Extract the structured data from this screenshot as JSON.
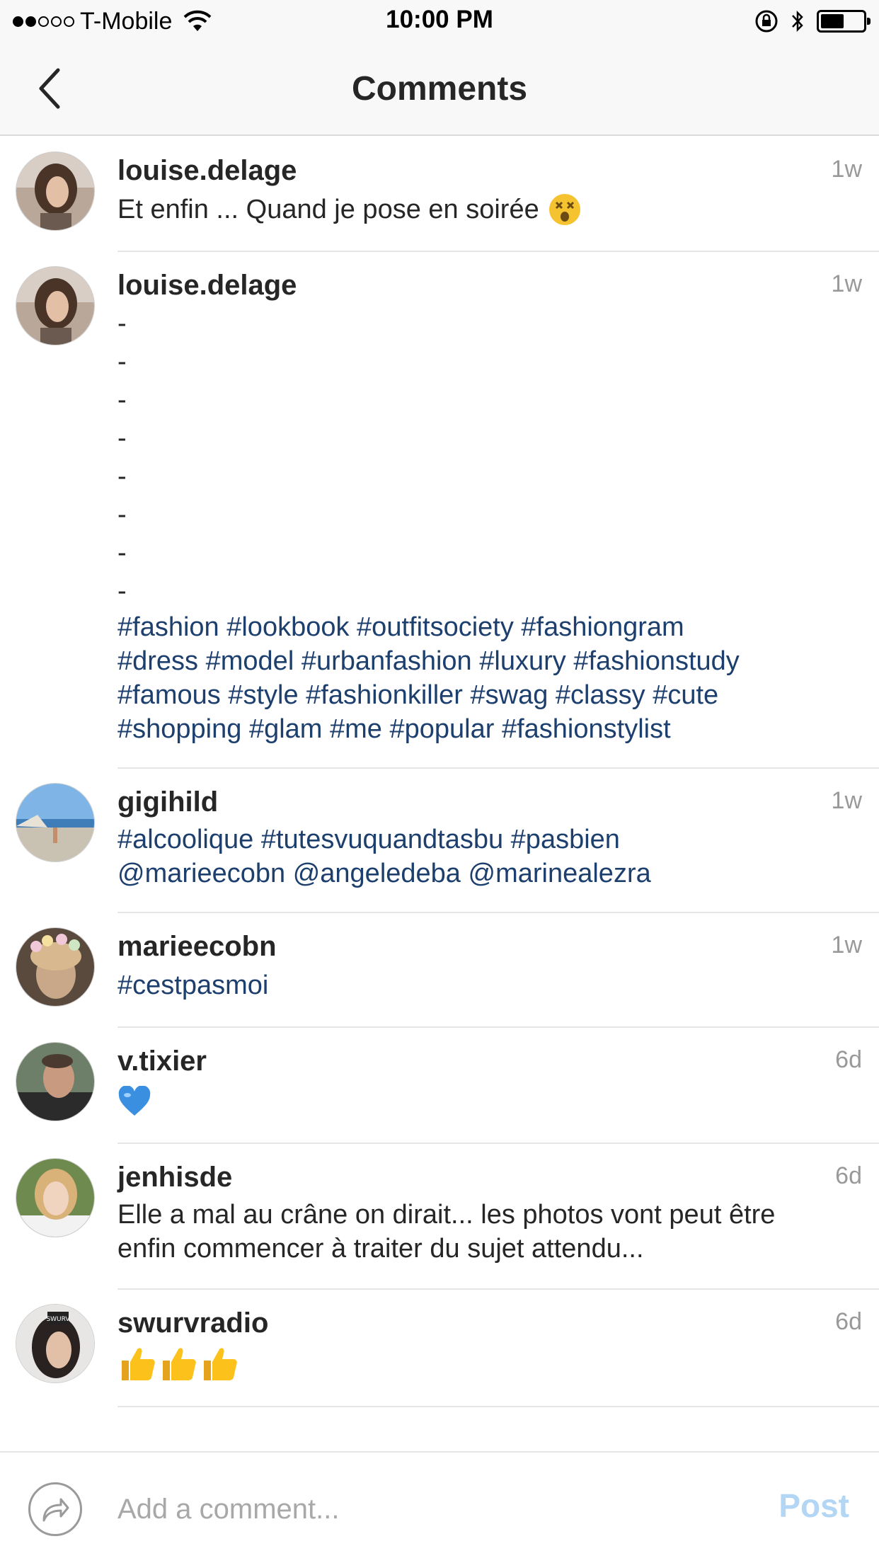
{
  "status_bar": {
    "carrier": "T-Mobile",
    "time": "10:00 PM",
    "signal_bars_filled": 2,
    "signal_bars_total": 5,
    "battery_level": 0.55
  },
  "nav": {
    "title": "Comments",
    "back_icon": "chevron-left-icon"
  },
  "comments": [
    {
      "username": "louise.delage",
      "time": "1w",
      "text": "Et enfin ... Quand je pose en soirée",
      "emoji": "dizzy-face-emoji"
    },
    {
      "username": "louise.delage",
      "time": "1w",
      "dashes": [
        "-",
        "-",
        "-",
        "-",
        "-",
        "-",
        "-",
        "-"
      ],
      "tags": [
        "#fashion",
        "#lookbook",
        "#outfitsociety",
        "#fashiongram",
        "#dress",
        "#model",
        "#urbanfashion",
        "#luxury",
        "#fashionstudy",
        "#famous",
        "#style",
        "#fashionkiller",
        "#swag",
        "#classy",
        "#cute",
        "#shopping",
        "#glam",
        "#me",
        "#popular",
        "#fashionstylist"
      ]
    },
    {
      "username": "gigihild",
      "time": "1w",
      "tags": [
        "#alcoolique",
        "#tutesvuquandtasbu",
        "#pasbien",
        "@marieecobn",
        "@angeledeba",
        "@marinealezra"
      ]
    },
    {
      "username": "marieecobn",
      "time": "1w",
      "tags": [
        "#cestpasmoi"
      ]
    },
    {
      "username": "v.tixier",
      "time": "6d",
      "emoji": "blue-heart-emoji"
    },
    {
      "username": "jenhisde",
      "time": "6d",
      "text": "Elle a mal au crâne on dirait... les photos vont peut être enfin commencer à traiter du sujet attendu..."
    },
    {
      "username": "swurvradio",
      "time": "6d",
      "emoji": "thumbs-up-emoji-x3"
    }
  ],
  "input": {
    "placeholder": "Add a comment...",
    "post_label": "Post",
    "share_icon": "share-arrow-icon"
  },
  "colors": {
    "hashtag": "#1d3f6e",
    "post_disabled": "#b3d6f5",
    "timestamp": "#999999"
  }
}
